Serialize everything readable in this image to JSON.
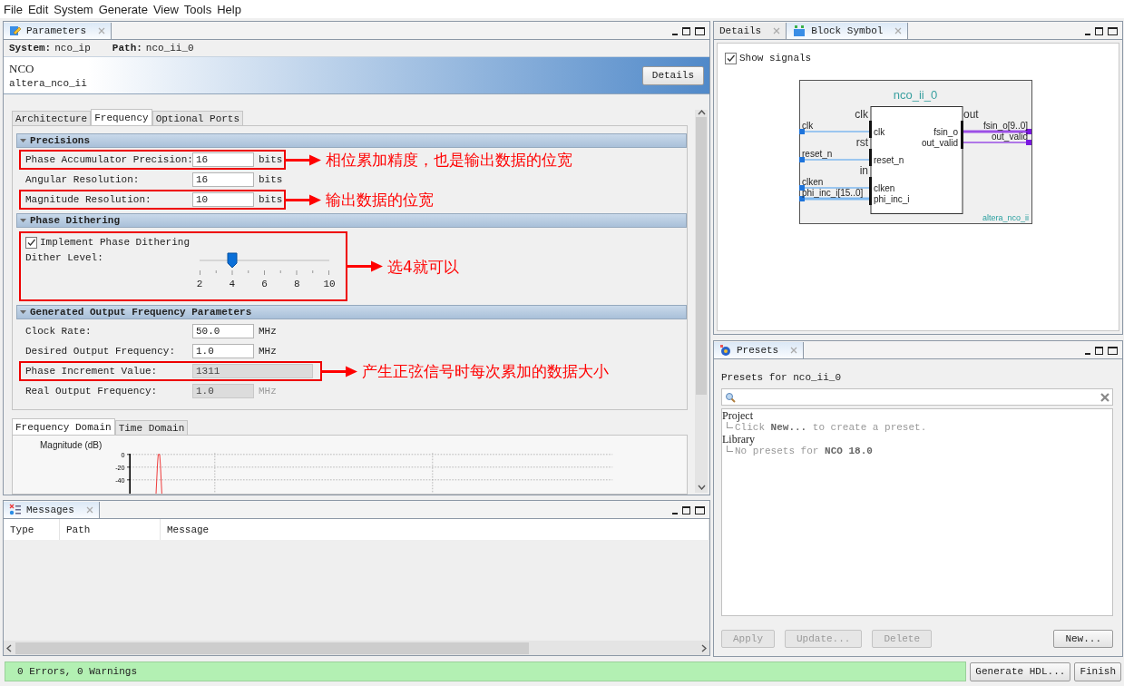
{
  "menu": [
    "File",
    "Edit",
    "System",
    "Generate",
    "View",
    "Tools",
    "Help"
  ],
  "parameters_panel": {
    "tab": "Parameters",
    "system_label": "System:",
    "system": "nco_ip",
    "path_label": "Path:",
    "path": "nco_ii_0",
    "component": "NCO",
    "component_id": "altera_nco_ii",
    "details_button": "Details",
    "tabs": [
      {
        "label": "Architecture",
        "selected": false
      },
      {
        "label": "Frequency",
        "selected": true
      },
      {
        "label": "Optional Ports",
        "selected": false
      }
    ],
    "sections": [
      {
        "title": "Precisions",
        "expanded": true,
        "items": [
          {
            "kind": "field",
            "label": "Phase Accumulator Precision:",
            "value": "16",
            "unit": "bits",
            "disabled": false,
            "annotation": "相位累加精度，也是输出数据的位宽"
          },
          {
            "kind": "field",
            "label": "Angular Resolution:",
            "value": "16",
            "unit": "bits",
            "disabled": false
          },
          {
            "kind": "field",
            "label": "Magnitude Resolution:",
            "value": "10",
            "unit": "bits",
            "disabled": false,
            "annotation": "输出数据的位宽"
          }
        ]
      },
      {
        "title": "Phase Dithering",
        "expanded": true,
        "items": [
          {
            "kind": "group",
            "annotation": "选4就可以",
            "items": [
              {
                "kind": "checkbox",
                "label": "Implement Phase Dithering",
                "checked": true
              },
              {
                "kind": "slider",
                "label": "Dither Level:",
                "level": 0.25,
                "ticks": [
                  "2",
                  "4",
                  "6",
                  "8",
                  "10"
                ]
              }
            ]
          }
        ]
      },
      {
        "title": "Generated Output Frequency Parameters",
        "expanded": true,
        "items": [
          {
            "kind": "field",
            "label": "Clock Rate:",
            "value": "50.0",
            "unit": "MHz",
            "disabled": false
          },
          {
            "kind": "field",
            "label": "Desired Output Frequency:",
            "value": "1.0",
            "unit": "MHz",
            "disabled": false
          },
          {
            "kind": "wide_field",
            "label": "Phase Increment Value:",
            "value": "1311",
            "disabled": true,
            "annotation": "产生正弦信号时每次累加的数据大小"
          },
          {
            "kind": "field",
            "label": "Real Output Frequency:",
            "value": "1.0",
            "unit": "MHz",
            "disabled": true
          }
        ]
      }
    ],
    "plot_tabs": [
      {
        "label": "Frequency Domain",
        "selected": true
      },
      {
        "label": "Time Domain",
        "selected": false
      }
    ],
    "plot": {
      "title": "Magnitude (dB)",
      "tick_labels": [
        "0",
        "-20",
        "-40"
      ]
    }
  },
  "messages_panel": {
    "tab": "Messages",
    "columns": [
      "Type",
      "Path",
      "Message"
    ]
  },
  "block_panel": {
    "tabs": [
      {
        "label": "Details",
        "selected": false
      },
      {
        "label": "Block Symbol",
        "selected": true
      }
    ],
    "show_signals": {
      "label": "Show signals",
      "checked": true
    },
    "symbol": {
      "instance": "nco_ii_0",
      "module": "altera_nco_ii",
      "interfaces": [
        {
          "kind": "input",
          "name": "clk",
          "ports": [
            {
              "signal": "clk",
              "port": "clk",
              "bus": false
            }
          ]
        },
        {
          "kind": "input",
          "name": "rst",
          "ports": [
            {
              "signal": "reset_n",
              "port": "reset_n",
              "bus": false
            }
          ]
        },
        {
          "kind": "input",
          "name": "in",
          "ports": [
            {
              "signal": "clken",
              "port": "clken",
              "bus": false
            },
            {
              "signal": "phi_inc_i[15..0]",
              "port": "phi_inc_i",
              "bus": true
            }
          ]
        },
        {
          "kind": "output",
          "name": "out",
          "ports": [
            {
              "signal": "fsin_o[9..0]",
              "port": "fsin_o",
              "bus": true
            },
            {
              "signal": "out_valid",
              "port": "out_valid",
              "bus": false
            }
          ]
        }
      ]
    }
  },
  "presets_panel": {
    "tab": "Presets",
    "heading": "Presets for nco_ii_0",
    "tree": [
      {
        "label": "Project",
        "children": [
          {
            "label": "Click **New...** to create a preset."
          }
        ]
      },
      {
        "label": "Library",
        "children": [
          {
            "label": "No presets for **NCO 18.0**"
          }
        ]
      }
    ],
    "buttons": [
      {
        "label": "Apply",
        "disabled": true
      },
      {
        "label": "Update...",
        "disabled": true
      },
      {
        "label": "Delete",
        "disabled": true
      },
      {
        "label": "New...",
        "disabled": false
      }
    ]
  },
  "status": {
    "text": "0 Errors, 0 Warnings"
  },
  "footer_buttons": [
    "Generate HDL...",
    "Finish"
  ]
}
